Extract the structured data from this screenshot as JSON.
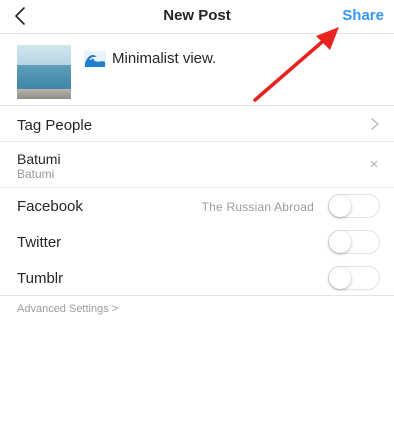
{
  "nav": {
    "title": "New Post",
    "share_label": "Share",
    "back_icon": "chevron-left-icon"
  },
  "post": {
    "caption": "Minimalist view.",
    "emoji_icon": "water-wave-icon"
  },
  "tag_people": {
    "label": "Tag People",
    "icon": "chevron-right-icon"
  },
  "location": {
    "name": "Batumi",
    "subtitle": "Batumi",
    "remove_icon": "close-icon"
  },
  "sharing": {
    "facebook": {
      "label": "Facebook",
      "account": "The Russian Abroad",
      "enabled": false
    },
    "twitter": {
      "label": "Twitter",
      "enabled": false
    },
    "tumblr": {
      "label": "Tumblr",
      "enabled": false
    }
  },
  "advanced_settings": "Advanced Settings >",
  "colors": {
    "accent": "#3897f0",
    "annotation_arrow": "#e8221f",
    "divider": "#e4e4e4"
  }
}
